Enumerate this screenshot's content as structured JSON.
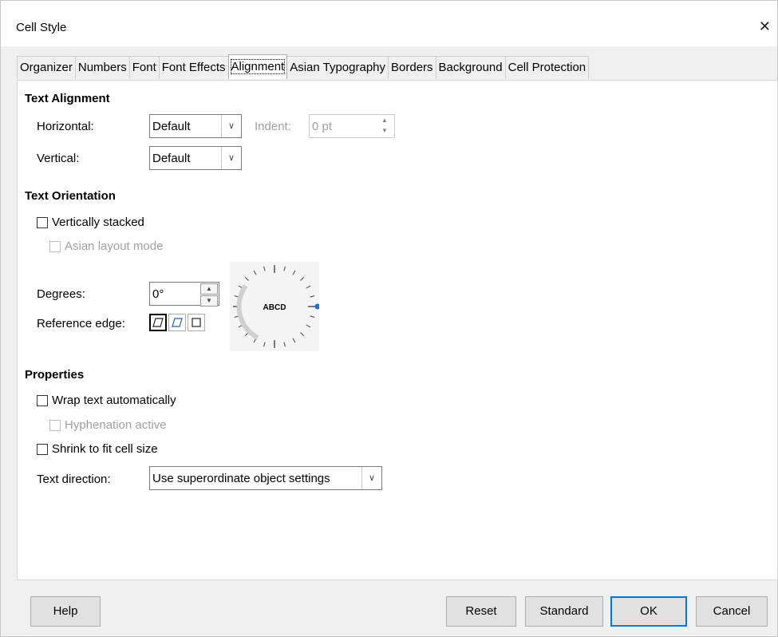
{
  "window": {
    "title": "Cell Style"
  },
  "tabs": [
    {
      "label": "Organizer"
    },
    {
      "label": "Numbers"
    },
    {
      "label": "Font"
    },
    {
      "label": "Font Effects"
    },
    {
      "label": "Alignment",
      "active": true
    },
    {
      "label": "Asian Typography"
    },
    {
      "label": "Borders"
    },
    {
      "label": "Background"
    },
    {
      "label": "Cell Protection"
    }
  ],
  "text_alignment": {
    "heading": "Text Alignment",
    "horizontal_label": "Horizontal:",
    "horizontal_value": "Default",
    "indent_label": "Indent:",
    "indent_value": "0 pt",
    "vertical_label": "Vertical:",
    "vertical_value": "Default"
  },
  "text_orientation": {
    "heading": "Text Orientation",
    "vertically_stacked": "Vertically stacked",
    "asian_layout": "Asian layout mode",
    "degrees_label": "Degrees:",
    "degrees_value": "0°",
    "reference_label": "Reference edge:",
    "dial_text": "ABCD"
  },
  "properties": {
    "heading": "Properties",
    "wrap": "Wrap text automatically",
    "hyphenation": "Hyphenation active",
    "shrink": "Shrink to fit cell size",
    "direction_label": "Text direction:",
    "direction_value": "Use superordinate object settings"
  },
  "buttons": {
    "help": "Help",
    "reset": "Reset",
    "standard": "Standard",
    "ok": "OK",
    "cancel": "Cancel"
  },
  "colors": {
    "accent": "#0078d7",
    "dial_indicator": "#1e6fd9"
  }
}
